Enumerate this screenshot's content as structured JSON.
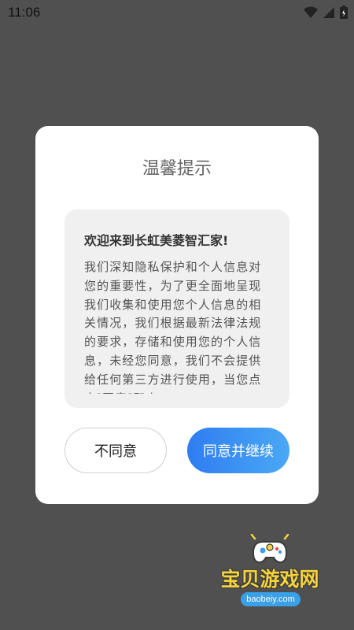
{
  "status_bar": {
    "time": "11:06",
    "icons": [
      "wifi-icon",
      "signal-icon",
      "battery-icon"
    ]
  },
  "dialog": {
    "title": "温馨提示",
    "heading": "欢迎来到长虹美菱智汇家!",
    "body": "我们深知隐私保护和个人信息对您的重要性，为了更全面地呈现我们收集和使用您个人信息的相关情况，我们根据最新法律法规的要求，存储和使用您的个人信息，未经您同意，我们不会提供给任何第三方进行使用，当您点击[同意]即表",
    "buttons": {
      "disagree": "不同意",
      "agree": "同意并继续"
    }
  },
  "watermark": {
    "text": "宝贝游戏网",
    "url": "baobeiy.com"
  },
  "colors": {
    "overlay": "#505050",
    "accent_start": "#2f7df1",
    "accent_end": "#4aa8f5",
    "watermark_yellow": "#f6d33c"
  }
}
